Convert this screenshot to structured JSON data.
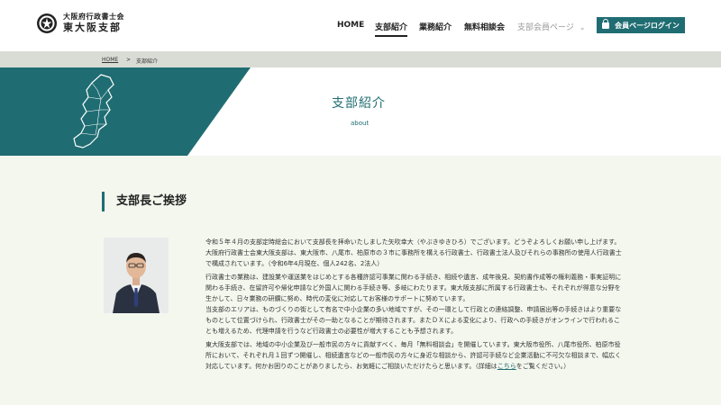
{
  "header": {
    "logo_line1": "大阪府行政書士会",
    "logo_line2": "東大阪支部",
    "logo_icon": "crest-icon"
  },
  "nav": {
    "items": [
      {
        "label": "HOME"
      },
      {
        "label": "支部紹介"
      },
      {
        "label": "業務紹介"
      },
      {
        "label": "無料相談会"
      },
      {
        "label": "支部会員ページ"
      }
    ],
    "login_label": "会員ページログイン"
  },
  "breadcrumb": {
    "home": "HOME",
    "separator": ">",
    "current": "支部紹介"
  },
  "hero": {
    "title": "支部紹介",
    "subtitle": "about"
  },
  "main": {
    "section_title": "支部長ご挨拶",
    "paragraphs": [
      "令和５年４月の支部定時総会において支部長を拝命いたしました矢吹幸大（やぶきゆきひろ）でございます。どうぞよろしくお願い申し上げます。",
      "大阪府行政書士会東大阪支部は、東大阪市、八尾市、柏原市の３市に事務所を構える行政書士、行政書士法人及びそれらの事務所の使用人行政書士で構成されています。（令和6年4月現在、個人242名、2法人）",
      "行政書士の業務は、建設業や運送業をはじめとする各種許認可事業に関わる手続き、相続や遺言、成年後見、契約書作成等の権利義務・事実証明に関わる手続き、在留許可や帰化申請など外国人に関わる手続き等、多岐にわたります。東大阪支部に所属する行政書士も、それぞれが得意な分野を生かして、日々業務の研鑽に努め、時代の変化に対応してお客様のサポートに努めています。",
      "当支部のエリアは、ものづくりの街として有名で中小企業の多い地域ですが、その一環として行政との連絡調整、申請届出等の手続きはより重要なものとして位置づけられ、行政書士がその一助となることが期待されます。またＤＸによる変化により、行政への手続きがオンラインで行われることも増えるため、代理申請を行うなど行政書士の必要性が増大することも予想されます。",
      "東大阪支部では、地域の中小企業及び一般市民の方々に貢献すべく、毎月「無料相談会」を開催しています。東大阪市役所、八尾市役所、柏原市役所において、それぞれ月１回ずつ開催し、相続遺言などの一般市民の方々に身近な相談から、許認可手続など企業活動に不可欠な相談まで、幅広く対応しています。何かお困りのことがありましたら、お気軽にご相談いただけたらと思います。（詳細は"
    ],
    "link_text": "こちら",
    "after_link": "をご覧ください。）"
  },
  "colors": {
    "accent": "#1f6d72",
    "background": "#f4f7ee",
    "breadcrumb_bg": "#d8dcd5"
  }
}
